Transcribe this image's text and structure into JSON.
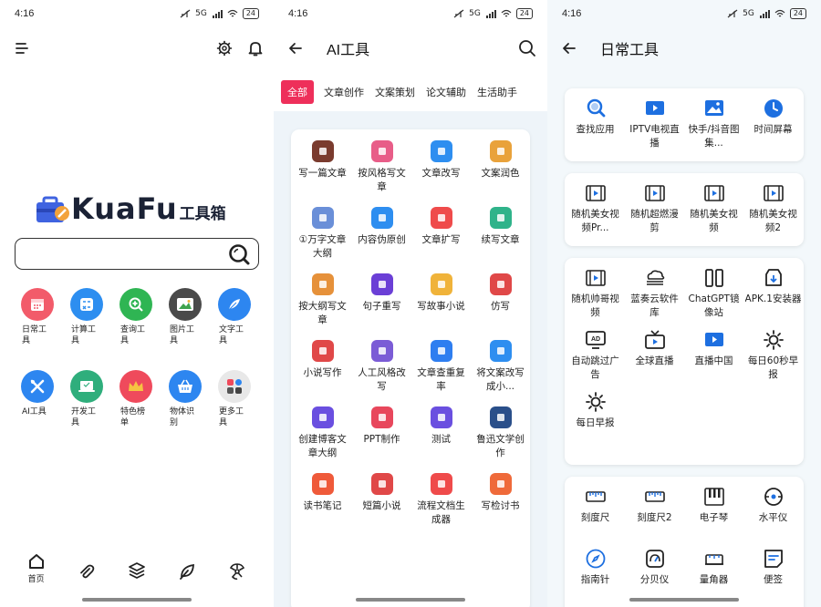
{
  "status": {
    "time": "4:16",
    "signal": "5G",
    "battery": "24"
  },
  "home": {
    "logo_text": "KuaFu",
    "logo_suffix": "工具箱",
    "search_placeholder": "",
    "categories": [
      {
        "label": "日常工具",
        "icon": "calendar-icon",
        "color": "#f25b6a"
      },
      {
        "label": "计算工具",
        "icon": "calculator-icon",
        "color": "#2d8ef0"
      },
      {
        "label": "查询工具",
        "icon": "search-plus-icon",
        "color": "#2fb553"
      },
      {
        "label": "图片工具",
        "icon": "image-icon",
        "color": "#4a4a4a"
      },
      {
        "label": "文字工具",
        "icon": "feather-icon",
        "color": "#2d86f0"
      },
      {
        "label": "AI工具",
        "icon": "wrench-icon",
        "color": "#2d86f0"
      },
      {
        "label": "开发工具",
        "icon": "laptop-icon",
        "color": "#2fae7c"
      },
      {
        "label": "特色榜单",
        "icon": "crown-icon",
        "color": "#ef4a5c"
      },
      {
        "label": "物体识别",
        "icon": "basket-icon",
        "color": "#2d86f0"
      },
      {
        "label": "更多工具",
        "icon": "grid-more-icon",
        "color": "#e8e8e8"
      }
    ],
    "nav": [
      {
        "label": "首页",
        "icon": "home-icon"
      },
      {
        "label": "",
        "icon": "paperclip-icon"
      },
      {
        "label": "",
        "icon": "layers-icon"
      },
      {
        "label": "",
        "icon": "leaf-icon"
      },
      {
        "label": "",
        "icon": "radiation-icon"
      }
    ]
  },
  "ai": {
    "title": "AI工具",
    "tabs": [
      "全部",
      "文章创作",
      "文案策划",
      "论文辅助",
      "生活助手"
    ],
    "tools": [
      {
        "label": "写一篇文章",
        "color": "#7a3b2e"
      },
      {
        "label": "按风格写文章",
        "color": "#e85d88"
      },
      {
        "label": "文章改写",
        "color": "#2e8ef0"
      },
      {
        "label": "文案润色",
        "color": "#e9a23b"
      },
      {
        "label": "①万字文章大纲",
        "color": "#6a8fd8"
      },
      {
        "label": "内容伪原创",
        "color": "#2e8ef0"
      },
      {
        "label": "文章扩写",
        "color": "#ef4b4b"
      },
      {
        "label": "续写文章",
        "color": "#2fb38a"
      },
      {
        "label": "按大纲写文章",
        "color": "#e6913a"
      },
      {
        "label": "句子重写",
        "color": "#6b3fd6"
      },
      {
        "label": "写故事小说",
        "color": "#f0b33a"
      },
      {
        "label": "仿写",
        "color": "#e04848"
      },
      {
        "label": "小说写作",
        "color": "#e04848"
      },
      {
        "label": "人工风格改写",
        "color": "#7b5cd6"
      },
      {
        "label": "文章查重复率",
        "color": "#2e7ef0"
      },
      {
        "label": "将文案改写成小...",
        "color": "#2e8ef0"
      },
      {
        "label": "创建博客文章大纲",
        "color": "#6a4fe0"
      },
      {
        "label": "PPT制作",
        "color": "#e8475c"
      },
      {
        "label": "测试",
        "color": "#6a4fe0"
      },
      {
        "label": "鲁迅文学创作",
        "color": "#2a4f8a"
      },
      {
        "label": "读书笔记",
        "color": "#ef5a3a"
      },
      {
        "label": "短篇小说",
        "color": "#e04848"
      },
      {
        "label": "流程文档生成器",
        "color": "#ef4b4b"
      },
      {
        "label": "写检讨书",
        "color": "#ef6a3a"
      }
    ]
  },
  "daily": {
    "title": "日常工具",
    "group1": [
      {
        "label": "查找应用",
        "icon": "magnifier-icon"
      },
      {
        "label": "IPTV电视直播",
        "icon": "tv-icon"
      },
      {
        "label": "快手/抖音图集...",
        "icon": "picture-icon"
      },
      {
        "label": "时间屏幕",
        "icon": "clock-icon"
      }
    ],
    "group2": [
      {
        "label": "随机美女视频Pr...",
        "icon": "film-icon"
      },
      {
        "label": "随机超燃漫剪",
        "icon": "film-icon"
      },
      {
        "label": "随机美女视频",
        "icon": "film-icon"
      },
      {
        "label": "随机美女视频2",
        "icon": "film-icon"
      }
    ],
    "group3": [
      {
        "label": "随机帅哥视频",
        "icon": "film-icon"
      },
      {
        "label": "蓝奏云软件库",
        "icon": "cloud-icon"
      },
      {
        "label": "ChatGPT镜像站",
        "icon": "split-icon"
      },
      {
        "label": "APK.1安装器",
        "icon": "install-icon"
      },
      {
        "label": "自动跳过广告",
        "icon": "ad-icon"
      },
      {
        "label": "全球直播",
        "icon": "live-tv-icon"
      },
      {
        "label": "直播中国",
        "icon": "tv-icon"
      },
      {
        "label": "每日60秒早报",
        "icon": "sun-icon"
      },
      {
        "label": "每日早报",
        "icon": "sun-icon"
      }
    ],
    "group4": [
      {
        "label": "刻度尺",
        "icon": "ruler-icon"
      },
      {
        "label": "刻度尺2",
        "icon": "ruler-icon"
      },
      {
        "label": "电子琴",
        "icon": "piano-icon"
      },
      {
        "label": "水平仪",
        "icon": "level-icon"
      },
      {
        "label": "指南针",
        "icon": "compass-icon"
      },
      {
        "label": "分贝仪",
        "icon": "gauge-icon"
      },
      {
        "label": "量角器",
        "icon": "protractor-icon"
      },
      {
        "label": "便签",
        "icon": "note-icon"
      }
    ]
  }
}
